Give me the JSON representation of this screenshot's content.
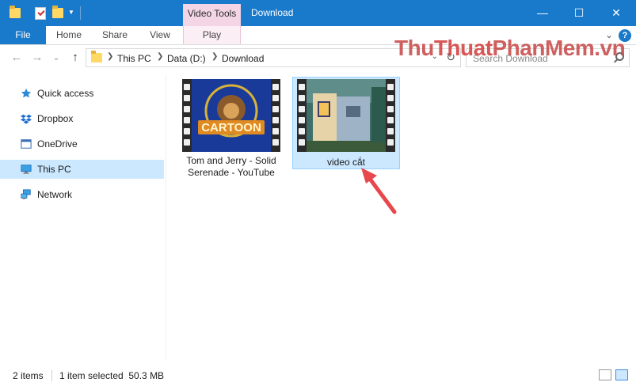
{
  "title_bar": {
    "context_tab_header": "Video Tools",
    "window_title": "Download",
    "minimize_glyph": "—",
    "maximize_glyph": "☐",
    "close_glyph": "✕"
  },
  "ribbon": {
    "tabs": [
      {
        "label": "File"
      },
      {
        "label": "Home"
      },
      {
        "label": "Share"
      },
      {
        "label": "View"
      },
      {
        "label": "Play"
      }
    ],
    "collapse_glyph": "⌄",
    "help_glyph": "?"
  },
  "nav_bar": {
    "back_glyph": "←",
    "forward_glyph": "→",
    "recent_glyph": "⌄",
    "up_glyph": "↑",
    "breadcrumbs": [
      "This PC",
      "Data (D:)",
      "Download"
    ],
    "search_placeholder": "Search Download"
  },
  "watermark": {
    "part1": "Thu",
    "part2": "Thuat",
    "part3": "PhanMem",
    "part4": ".vn"
  },
  "nav_pane": {
    "items": [
      {
        "label": "Quick access",
        "icon": "star-icon"
      },
      {
        "label": "Dropbox",
        "icon": "dropbox-icon"
      },
      {
        "label": "OneDrive",
        "icon": "cloud-icon"
      },
      {
        "label": "This PC",
        "icon": "computer-icon",
        "selected": true
      },
      {
        "label": "Network",
        "icon": "network-icon"
      }
    ]
  },
  "files": [
    {
      "name": "Tom and Jerry - Solid Serenade - YouTube",
      "line1": "Tom and Jerry - Solid",
      "line2": "Serenade - YouTube",
      "thumb_text": "CARTOON",
      "selected": false
    },
    {
      "name": "video cắt",
      "line1": "video cắt",
      "selected": true
    }
  ],
  "status_bar": {
    "item_count": "2 items",
    "selection": "1 item selected  50.3 MB"
  },
  "colors": {
    "accent": "#1979ca",
    "context_tab": "#f3d5e6",
    "selection": "#cce8ff",
    "arrow": "#e8474c"
  }
}
